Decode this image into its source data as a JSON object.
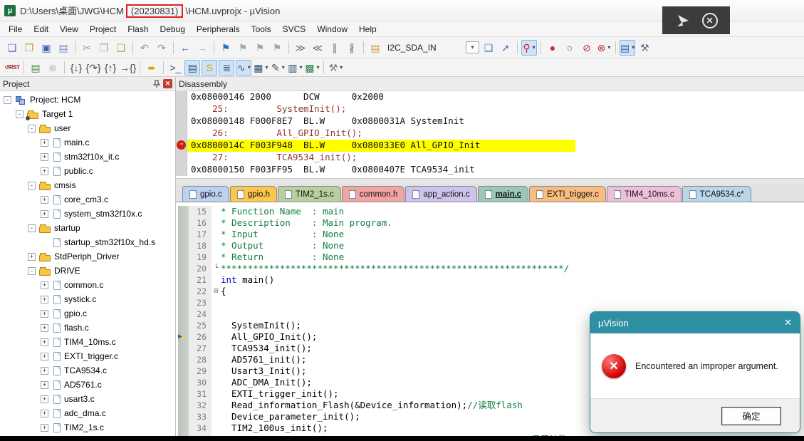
{
  "title_bar": {
    "path_prefix": "D:\\Users\\桌面\\JWG\\HCM",
    "highlighted": "(20230831)",
    "path_suffix": "\\HCM.uvprojx - µVision",
    "annotation_color": "#e31e1e",
    "app_icon_glyph": "µ"
  },
  "overlay": {
    "close_glyph": "✕"
  },
  "menu": {
    "items": [
      {
        "name": "menu-file",
        "label": "File"
      },
      {
        "name": "menu-edit",
        "label": "Edit"
      },
      {
        "name": "menu-view",
        "label": "View"
      },
      {
        "name": "menu-project",
        "label": "Project"
      },
      {
        "name": "menu-flash",
        "label": "Flash"
      },
      {
        "name": "menu-debug",
        "label": "Debug"
      },
      {
        "name": "menu-peripherals",
        "label": "Peripherals"
      },
      {
        "name": "menu-tools",
        "label": "Tools"
      },
      {
        "name": "menu-svcs",
        "label": "SVCS"
      },
      {
        "name": "menu-window",
        "label": "Window"
      },
      {
        "name": "menu-help",
        "label": "Help"
      }
    ]
  },
  "toolbar_main": {
    "items": [
      {
        "name": "new-file-icon",
        "glyph": "❏",
        "color": "#4a6db3"
      },
      {
        "name": "open-file-icon",
        "glyph": "❒",
        "color": "#c9972e"
      },
      {
        "name": "save-icon",
        "glyph": "▣",
        "color": "#3f5fb5"
      },
      {
        "name": "save-all-icon",
        "glyph": "▤",
        "color": "#7d92c9"
      },
      {
        "name": "separator",
        "type": "sep"
      },
      {
        "name": "cut-icon",
        "glyph": "✂",
        "color": "#9aa0a8"
      },
      {
        "name": "copy-icon",
        "glyph": "❐",
        "color": "#9aa0a8"
      },
      {
        "name": "paste-icon",
        "glyph": "❑",
        "color": "#b9a14e"
      },
      {
        "name": "separator",
        "type": "sep"
      },
      {
        "name": "undo-icon",
        "glyph": "↶",
        "color": "#8d94a0"
      },
      {
        "name": "redo-icon",
        "glyph": "↷",
        "color": "#8d94a0"
      },
      {
        "name": "separator",
        "type": "sep"
      },
      {
        "name": "navigate-back-icon",
        "glyph": "←",
        "color": "#2f6fd0"
      },
      {
        "name": "navigate-forward-icon",
        "glyph": "→",
        "color": "#aab2bd"
      },
      {
        "name": "separator",
        "type": "sep"
      },
      {
        "name": "insert-bookmark-icon",
        "glyph": "⚑",
        "color": "#1f72c9"
      },
      {
        "name": "prev-bookmark-icon",
        "glyph": "⚑",
        "color": "#9aa6b5"
      },
      {
        "name": "next-bookmark-icon",
        "glyph": "⚑",
        "color": "#9aa6b5"
      },
      {
        "name": "clear-bookmarks-icon",
        "glyph": "⚑",
        "color": "#9aa6b5"
      },
      {
        "name": "separator",
        "type": "sep"
      },
      {
        "name": "indent-icon",
        "glyph": "≫",
        "color": "#6b7785"
      },
      {
        "name": "outdent-icon",
        "glyph": "≪",
        "color": "#6b7785"
      },
      {
        "name": "comment-icon",
        "glyph": "∥",
        "color": "#6b7785"
      },
      {
        "name": "uncomment-icon",
        "glyph": "∦",
        "color": "#6b7785"
      },
      {
        "name": "separator",
        "type": "sep"
      },
      {
        "name": "open-book-icon",
        "glyph": "▤",
        "color": "#d3a03b"
      },
      {
        "name": "symbol-combo-input",
        "type": "field",
        "glyph": "I2C_SDA_IN"
      },
      {
        "name": "symbol-combo-dropdown",
        "type": "combo",
        "glyph": "▾",
        "color": "#5a6470"
      },
      {
        "name": "find-in-files-icon",
        "glyph": "❏",
        "color": "#4a7ab5"
      },
      {
        "name": "goto-definition-icon",
        "glyph": "➚",
        "color": "#3f6fd0"
      },
      {
        "name": "separator",
        "type": "sep"
      },
      {
        "name": "current-statement-magnifier-icon",
        "glyph": "⚲",
        "color": "#cc2020",
        "hl": true,
        "dd": true
      },
      {
        "name": "separator",
        "type": "sep"
      },
      {
        "name": "insert-breakpoint-icon",
        "glyph": "●",
        "color": "#c42b2b"
      },
      {
        "name": "enable-breakpoint-icon",
        "glyph": "○",
        "color": "#c42b2b"
      },
      {
        "name": "disable-breakpoints-icon",
        "glyph": "⊘",
        "color": "#c42b2b"
      },
      {
        "name": "kill-breakpoints-icon",
        "glyph": "⊗",
        "color": "#c42b2b",
        "dd": true
      },
      {
        "name": "separator",
        "type": "sep"
      },
      {
        "name": "books-window-icon",
        "glyph": "▤",
        "color": "#3f6ab5",
        "hl": true,
        "dd": true
      },
      {
        "name": "configuration-wrench-icon",
        "glyph": "⚒",
        "color": "#5d7590"
      }
    ]
  },
  "toolbar_debug": {
    "items": [
      {
        "name": "reset-cpu-icon",
        "type": "text",
        "glyph": "↺RST",
        "color": "#a02020"
      },
      {
        "name": "separator",
        "type": "sep"
      },
      {
        "name": "translate-file-icon",
        "glyph": "▤",
        "color": "#5a8a46"
      },
      {
        "name": "stop-build-icon",
        "glyph": "⊗",
        "color": "#b6b6b6"
      },
      {
        "name": "separator",
        "type": "sep"
      },
      {
        "name": "step-into-icon",
        "glyph": "{↓}",
        "color": "#3a4a5a"
      },
      {
        "name": "step-over-icon",
        "glyph": "{↷}",
        "color": "#3a4a5a"
      },
      {
        "name": "step-out-icon",
        "glyph": "{↑}",
        "color": "#3a4a5a"
      },
      {
        "name": "run-to-cursor-icon",
        "glyph": "→{}",
        "color": "#3a4a5a"
      },
      {
        "name": "separator",
        "type": "sep"
      },
      {
        "name": "go-run-icon",
        "glyph": "➨",
        "color": "#e0a400"
      },
      {
        "name": "separator",
        "type": "sep"
      },
      {
        "name": "command-window-icon",
        "glyph": ">_",
        "color": "#2f4f6f"
      },
      {
        "name": "disassembly-window-icon",
        "glyph": "▤",
        "color": "#35506b",
        "hl": true
      },
      {
        "name": "symbols-window-icon",
        "glyph": "S",
        "color": "#caa21f",
        "hl": true
      },
      {
        "name": "serial-window-icon",
        "glyph": "≣",
        "color": "#35506b",
        "hl": true
      },
      {
        "name": "analysis-window-icon",
        "glyph": "∿",
        "color": "#35506b",
        "hl": true,
        "dd": true
      },
      {
        "name": "system-viewer-icon",
        "glyph": "▦",
        "color": "#35506b",
        "dd": true
      },
      {
        "name": "watch-window-icon",
        "glyph": "✎",
        "color": "#35506b",
        "dd": true
      },
      {
        "name": "memory-window-icon",
        "glyph": "▥",
        "color": "#35506b",
        "dd": true
      },
      {
        "name": "peripherals-icon",
        "glyph": "▩",
        "color": "#2f7d4f",
        "dd": true
      },
      {
        "name": "separator",
        "type": "sep"
      },
      {
        "name": "toolbox-icon",
        "glyph": "⚒",
        "color": "#6b7a90",
        "dd": true
      }
    ]
  },
  "project_panel": {
    "title": "Project",
    "tree": [
      {
        "name": "tree-project-hcm",
        "level": 0,
        "expander": "-",
        "icon": "project",
        "label": "Project: HCM"
      },
      {
        "name": "tree-target-1",
        "level": 1,
        "expander": "-",
        "icon": "target",
        "label": "Target 1"
      },
      {
        "name": "tree-folder-user",
        "level": 2,
        "expander": "-",
        "icon": "folder-open",
        "label": "user"
      },
      {
        "name": "tree-file-main-c",
        "level": 3,
        "expander": "+",
        "icon": "file",
        "label": "main.c"
      },
      {
        "name": "tree-file-stm32f10x-it-c",
        "level": 3,
        "expander": "+",
        "icon": "file",
        "label": "stm32f10x_it.c"
      },
      {
        "name": "tree-file-public-c",
        "level": 3,
        "expander": "+",
        "icon": "file",
        "label": "public.c"
      },
      {
        "name": "tree-folder-cmsis",
        "level": 2,
        "expander": "-",
        "icon": "folder-open",
        "label": "cmsis"
      },
      {
        "name": "tree-file-core-cm3-c",
        "level": 3,
        "expander": "+",
        "icon": "file",
        "label": "core_cm3.c"
      },
      {
        "name": "tree-file-system-stm32f10x-c",
        "level": 3,
        "expander": "+",
        "icon": "file",
        "label": "system_stm32f10x.c"
      },
      {
        "name": "tree-folder-startup",
        "level": 2,
        "expander": "-",
        "icon": "folder-open",
        "label": "startup"
      },
      {
        "name": "tree-file-startup-stm32f10x-hd-s",
        "level": 3,
        "expander": "",
        "icon": "file",
        "label": "startup_stm32f10x_hd.s"
      },
      {
        "name": "tree-folder-stdperiph-driver",
        "level": 2,
        "expander": "+",
        "icon": "folder-closed",
        "label": "StdPeriph_Driver"
      },
      {
        "name": "tree-folder-drive",
        "level": 2,
        "expander": "-",
        "icon": "folder-open",
        "label": "DRIVE"
      },
      {
        "name": "tree-file-common-c",
        "level": 3,
        "expander": "+",
        "icon": "file",
        "label": "common.c"
      },
      {
        "name": "tree-file-systick-c",
        "level": 3,
        "expander": "+",
        "icon": "file",
        "label": "systick.c"
      },
      {
        "name": "tree-file-gpio-c",
        "level": 3,
        "expander": "+",
        "icon": "file",
        "label": "gpio.c"
      },
      {
        "name": "tree-file-flash-c",
        "level": 3,
        "expander": "+",
        "icon": "file",
        "label": "flash.c"
      },
      {
        "name": "tree-file-tim4-10ms-c",
        "level": 3,
        "expander": "+",
        "icon": "file",
        "label": "TIM4_10ms.c"
      },
      {
        "name": "tree-file-exti-trigger-c",
        "level": 3,
        "expander": "+",
        "icon": "file",
        "label": "EXTI_trigger.c"
      },
      {
        "name": "tree-file-tca9534-c",
        "level": 3,
        "expander": "+",
        "icon": "file",
        "label": "TCA9534.c"
      },
      {
        "name": "tree-file-ad5761-c",
        "level": 3,
        "expander": "+",
        "icon": "file",
        "label": "AD5761.c"
      },
      {
        "name": "tree-file-usart3-c",
        "level": 3,
        "expander": "+",
        "icon": "file",
        "label": "usart3.c"
      },
      {
        "name": "tree-file-adc-dma-c",
        "level": 3,
        "expander": "+",
        "icon": "file",
        "label": "adc_dma.c"
      },
      {
        "name": "tree-file-tim2-1s-c",
        "level": 3,
        "expander": "+",
        "icon": "file",
        "label": "TIM2_1s.c"
      }
    ]
  },
  "disassembly": {
    "title": "Disassembly",
    "lines": [
      {
        "text": "0x08000146 2000      DCW      0x2000",
        "type": "asm"
      },
      {
        "text": "    25:         SystemInit();",
        "type": "src"
      },
      {
        "text": "0x08000148 F000F8E7  BL.W     0x0800031A SystemInit",
        "type": "asm"
      },
      {
        "text": "    26:         All_GPIO_Init();",
        "type": "src"
      },
      {
        "text": "0x0800014C F003F948  BL.W     0x080033E0 All_GPIO_Init",
        "type": "cur",
        "mk": "cur"
      },
      {
        "text": "    27:         TCA9534_init();",
        "type": "src"
      },
      {
        "text": "0x08000150 F003FF95  BL.W     0x0800407E TCA9534_init",
        "type": "asm"
      }
    ]
  },
  "editor": {
    "tabs": [
      {
        "name": "tab-gpio-c",
        "label": "gpio.c",
        "color": "#bdd1f0"
      },
      {
        "name": "tab-gpio-h",
        "label": "gpio.h",
        "color": "#fbc84d"
      },
      {
        "name": "tab-tim2-1s-c",
        "label": "TIM2_1s.c",
        "color": "#b9cf9e"
      },
      {
        "name": "tab-common-h",
        "label": "common.h",
        "color": "#f2a3a3"
      },
      {
        "name": "tab-app-action-c",
        "label": "app_action.c",
        "color": "#cfc2ec"
      },
      {
        "name": "tab-main-c",
        "label": "main.c",
        "color": "#9dc7bb",
        "active": true
      },
      {
        "name": "tab-exti-trigger-c",
        "label": "EXTI_trigger.c",
        "color": "#f8bc80"
      },
      {
        "name": "tab-tim4-10ms-c",
        "label": "TIM4_10ms.c",
        "color": "#ecc0d8"
      },
      {
        "name": "tab-tca9534-c",
        "label": "TCA9534.c*",
        "color": "#b9d6ea"
      }
    ],
    "lines": [
      {
        "num": "15",
        "main": "* Function Name  : main",
        "mainCls": "com"
      },
      {
        "num": "16",
        "main": "* Description    : Main program.",
        "mainCls": "com"
      },
      {
        "num": "17",
        "main": "* Input          : None",
        "mainCls": "com"
      },
      {
        "num": "18",
        "main": "* Output         : None",
        "mainCls": "com"
      },
      {
        "num": "19",
        "main": "* Return         : None",
        "mainCls": "com"
      },
      {
        "num": "20",
        "fold": "└",
        "main": "****************************************************************/",
        "mainCls": "com"
      },
      {
        "num": "21",
        "main": "int",
        "mainCls": "kw",
        "tail": " main()",
        "tailCls": "pln"
      },
      {
        "num": "22",
        "fold": "⊟",
        "main": "{",
        "mainCls": "pln"
      },
      {
        "num": "23"
      },
      {
        "num": "24"
      },
      {
        "num": "25",
        "main": "  SystemInit();",
        "mainCls": "pln"
      },
      {
        "num": "26",
        "mk": "arrow",
        "main": "  All_GPIO_Init();",
        "mainCls": "pln"
      },
      {
        "num": "27",
        "main": "  TCA9534_init();",
        "mainCls": "pln"
      },
      {
        "num": "28",
        "main": "  AD5761_init();",
        "mainCls": "pln"
      },
      {
        "num": "29",
        "main": "  Usart3_Init();",
        "mainCls": "pln"
      },
      {
        "num": "30",
        "main": "  ADC_DMA_Init();",
        "mainCls": "pln"
      },
      {
        "num": "31",
        "main": "  EXTI_trigger_init();",
        "mainCls": "pln"
      },
      {
        "num": "32",
        "main": "  Read_information_Flash(&Device_information);",
        "mainCls": "pln",
        "tail": "//读取flash",
        "tailCls": "com"
      },
      {
        "num": "33",
        "main": "  Device_parameter_init();",
        "mainCls": "pln"
      },
      {
        "num": "34",
        "main": "  TIM2_100us_init();",
        "mainCls": "pln"
      },
      {
        "num": "",
        "main": "                                                          ",
        "mainCls": "pln",
        "tail": "显示计数",
        "tailCls": "com"
      }
    ]
  },
  "dialog": {
    "title": "µVision",
    "close_glyph": "✕",
    "error_glyph": "✕",
    "message": "Encountered an improper argument.",
    "ok_label": "确定",
    "titlebar_color": "#2e91a3"
  },
  "colors": {
    "annotation_red": "#e31e1e",
    "dialog_teal": "#2e91a3",
    "current_line_yellow": "#ffff00",
    "error_red": "#cf1d1d",
    "highlight_toolbar": "#cfe3f7"
  }
}
